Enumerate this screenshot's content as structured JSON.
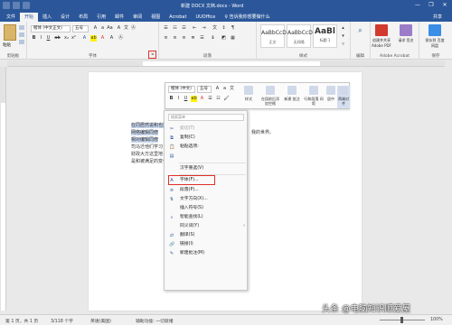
{
  "titlebar": {
    "title": "新建 DOCX 文档.docx - Word",
    "user_label": "",
    "minimize": "—",
    "restore": "❐",
    "close": "✕"
  },
  "tabs": [
    "文件",
    "开始",
    "插入",
    "设计",
    "布局",
    "引用",
    "邮件",
    "审阅",
    "视图",
    "Acrobat",
    "UUOffice",
    "♀ 告诉我你想要做什么"
  ],
  "share_label": "共享",
  "ribbon": {
    "paste_label": "粘贴",
    "clipboard_label": "剪贴板",
    "font_label": "字体",
    "font_name": "楷体 (中文正文)",
    "font_size": "五号",
    "paragraph_label": "段落",
    "styles_label": "样式",
    "style_items": [
      {
        "preview": "AaBbCcDc",
        "name": "正文"
      },
      {
        "preview": "AaBbCcDc",
        "name": "无间隔"
      },
      {
        "preview": "AaBl",
        "name": "标题 1"
      }
    ],
    "find_label": "编辑",
    "adobe_buttons": [
      {
        "label": "创建并共享\nAdobe PDF"
      },
      {
        "label": "请求\n签名"
      }
    ],
    "adobe_group_label": "Adobe Acrobat",
    "extra_buttons": [
      {
        "label": "保存到\n百度网盘"
      }
    ],
    "extra_group_label": "保存"
  },
  "document": {
    "lines": [
      "在同居然说和也没有放置一种东西更让我更多等自我",
      "网络编辑同修",
      "相对编辑同修",
      "司马迁他们学习",
      "财政大方这里地",
      "是和被满足的变化"
    ],
    "right_fragment": "我的世界。"
  },
  "mini_toolbar": {
    "font_name": "楷体 (中文)",
    "font_size": "五号",
    "big_buttons": [
      "样式",
      "在段前后添\n加空格",
      "新建\n批注",
      "行和段落\n间距",
      "居中",
      "两端对齐"
    ]
  },
  "context_menu": {
    "search_placeholder": "搜索菜单",
    "items": [
      {
        "label": "剪切(T)",
        "icon": "cut-icon",
        "glyph": "✂",
        "disabled": true
      },
      {
        "label": "复制(C)",
        "icon": "copy-icon",
        "glyph": "⧉",
        "disabled": false
      },
      {
        "label": "粘贴选项:",
        "icon": "paste-options-icon",
        "glyph": "📋",
        "disabled": false
      },
      {
        "label": "",
        "icon": "paste-keep-icon",
        "glyph": "▤",
        "disabled": false
      },
      {
        "label": "汉字重选(V)",
        "icon": "",
        "glyph": "",
        "disabled": false
      },
      {
        "label": "字体(F)...",
        "icon": "font-icon",
        "glyph": "A",
        "disabled": false
      },
      {
        "label": "段落(P)...",
        "icon": "paragraph-icon",
        "glyph": "≡",
        "disabled": false
      },
      {
        "label": "文字方向(X)...",
        "icon": "text-direction-icon",
        "glyph": "⇅",
        "disabled": false
      },
      {
        "label": "插入符号(S)",
        "icon": "",
        "glyph": "",
        "disabled": false
      },
      {
        "label": "智能查找(L)",
        "icon": "search-icon",
        "glyph": "⌕",
        "disabled": false
      },
      {
        "label": "同义词(Y)",
        "icon": "",
        "glyph": "",
        "disabled": false
      },
      {
        "label": "翻译(S)",
        "icon": "translate-icon",
        "glyph": "⇄",
        "disabled": false
      },
      {
        "label": "链接(I)",
        "icon": "link-icon",
        "glyph": "🔗",
        "disabled": false
      },
      {
        "label": "新建批注(M)",
        "icon": "comment-icon",
        "glyph": "✎",
        "disabled": false
      }
    ]
  },
  "statusbar": {
    "page": "第 1 页，共 1 页",
    "words": "3/118 个字",
    "language": "英语(美国)",
    "accessibility": "辅助功能: 一切就绪",
    "zoom": "100%"
  },
  "watermark": "头条 @电脑知识顺爱屋",
  "colors": {
    "accent": "#2b579a",
    "highlight": "#e0302a",
    "selection": "#c7d7ee"
  }
}
